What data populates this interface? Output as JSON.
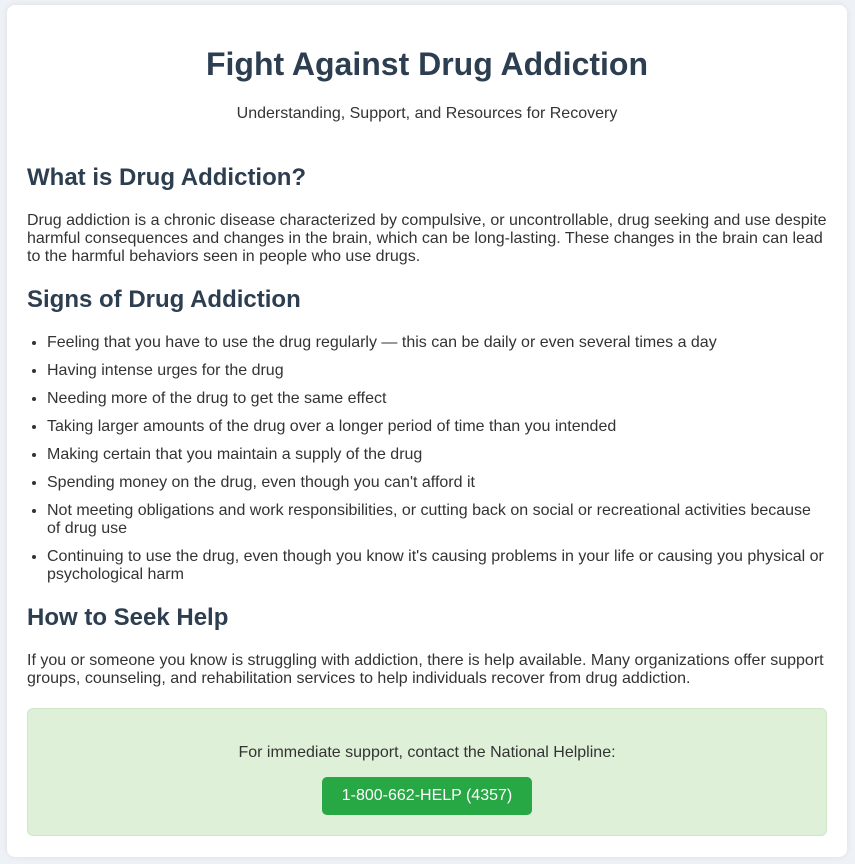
{
  "header": {
    "title": "Fight Against Drug Addiction",
    "subtitle": "Understanding, Support, and Resources for Recovery"
  },
  "sections": {
    "what": {
      "heading": "What is Drug Addiction?",
      "text": "Drug addiction is a chronic disease characterized by compulsive, or uncontrollable, drug seeking and use despite harmful consequences and changes in the brain, which can be long-lasting. These changes in the brain can lead to the harmful behaviors seen in people who use drugs."
    },
    "signs": {
      "heading": "Signs of Drug Addiction",
      "items": [
        "Feeling that you have to use the drug regularly — this can be daily or even several times a day",
        "Having intense urges for the drug",
        "Needing more of the drug to get the same effect",
        "Taking larger amounts of the drug over a longer period of time than you intended",
        "Making certain that you maintain a supply of the drug",
        "Spending money on the drug, even though you can't afford it",
        "Not meeting obligations and work responsibilities, or cutting back on social or recreational activities because of drug use",
        "Continuing to use the drug, even though you know it's causing problems in your life or causing you physical or psychological harm"
      ]
    },
    "help": {
      "heading": "How to Seek Help",
      "text": "If you or someone you know is struggling with addiction, there is help available. Many organizations offer support groups, counseling, and rehabilitation services to help individuals recover from drug addiction."
    }
  },
  "helpline": {
    "text": "For immediate support, contact the National Helpline:",
    "button_label": "1-800-662-HELP (4357)"
  },
  "colors": {
    "heading": "#2c3e50",
    "helpline_bg": "#dff0d8",
    "button_bg": "#28a745"
  }
}
